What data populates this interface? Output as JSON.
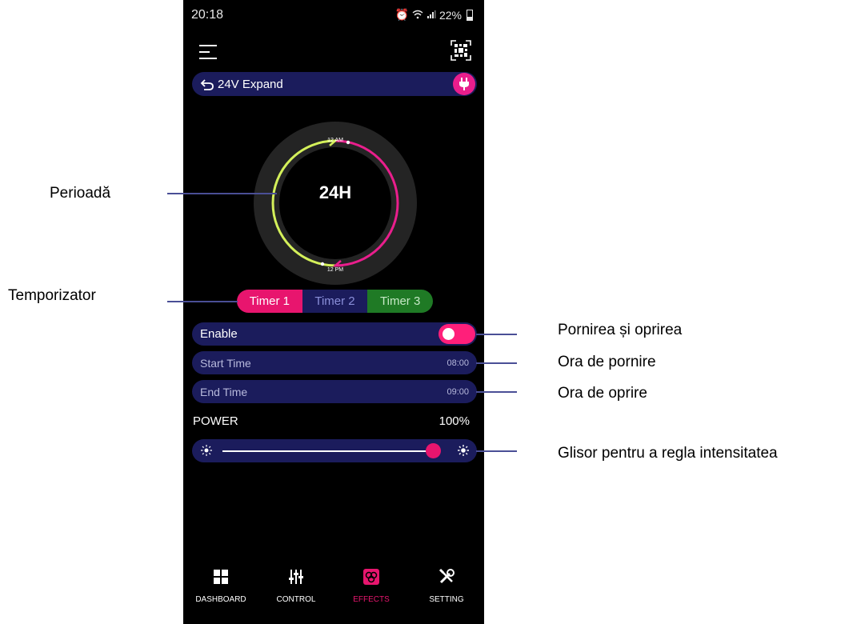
{
  "status_bar": {
    "time": "20:18",
    "battery": "22%"
  },
  "device": {
    "name": "24V Expand"
  },
  "dial": {
    "center_label": "24H",
    "top_label": "12 AM",
    "bottom_label": "12 PM"
  },
  "timers": {
    "tabs": [
      "Timer 1",
      "Timer 2",
      "Timer 3"
    ],
    "active_index": 0
  },
  "enable": {
    "label": "Enable",
    "on": true
  },
  "start_time": {
    "label": "Start Time",
    "value": "08:00"
  },
  "end_time": {
    "label": "End Time",
    "value": "09:00"
  },
  "power": {
    "label": "POWER",
    "value": "100%",
    "level": 1.0
  },
  "nav": {
    "items": [
      "DASHBOARD",
      "CONTROL",
      "EFFECTS",
      "SETTING"
    ],
    "active_index": 2
  },
  "annotations": {
    "period": "Perioadă",
    "timer": "Temporizator",
    "on_off": "Pornirea și oprirea",
    "start": "Ora de pornire",
    "stop": "Ora de oprire",
    "slider": "Glisor pentru a regla intensitatea"
  },
  "colors": {
    "accent_pink": "#e8156e",
    "panel_blue": "#1b1c5c",
    "timer3_green": "#1f7a25",
    "arc_yellow_green": "#d4f05a"
  }
}
